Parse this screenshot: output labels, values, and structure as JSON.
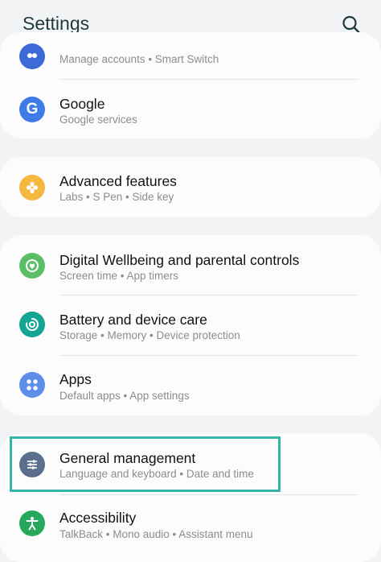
{
  "header": {
    "title": "Settings",
    "search_icon": "search-icon"
  },
  "top_card": {
    "partial_item": {
      "subtitle": "Manage accounts • Smart Switch",
      "icon": "accounts-icon",
      "color": "#3c6ad6"
    },
    "google": {
      "title": "Google",
      "subtitle": "Google services",
      "icon": "google-icon",
      "color": "#3e7be6"
    }
  },
  "advanced_card": {
    "advanced": {
      "title": "Advanced features",
      "subtitle": "Labs • S Pen • Side key",
      "icon": "puzzle-icon",
      "color": "#f4b840"
    }
  },
  "device_card": {
    "wellbeing": {
      "title": "Digital Wellbeing and parental controls",
      "subtitle": "Screen time • App timers",
      "icon": "wellbeing-icon",
      "color": "#5cbf68"
    },
    "battery": {
      "title": "Battery and device care",
      "subtitle": "Storage • Memory • Device protection",
      "icon": "device-care-icon",
      "color": "#14a594"
    },
    "apps": {
      "title": "Apps",
      "subtitle": "Default apps • App settings",
      "icon": "apps-grid-icon",
      "color": "#5c8fe8"
    }
  },
  "system_card": {
    "general": {
      "title": "General management",
      "subtitle": "Language and keyboard • Date and time",
      "icon": "sliders-icon",
      "color": "#5b6f8c"
    },
    "accessibility": {
      "title": "Accessibility",
      "subtitle": "TalkBack • Mono audio • Assistant menu",
      "icon": "accessibility-icon",
      "color": "#28a85c"
    }
  },
  "highlight_color": "#36b5a8"
}
